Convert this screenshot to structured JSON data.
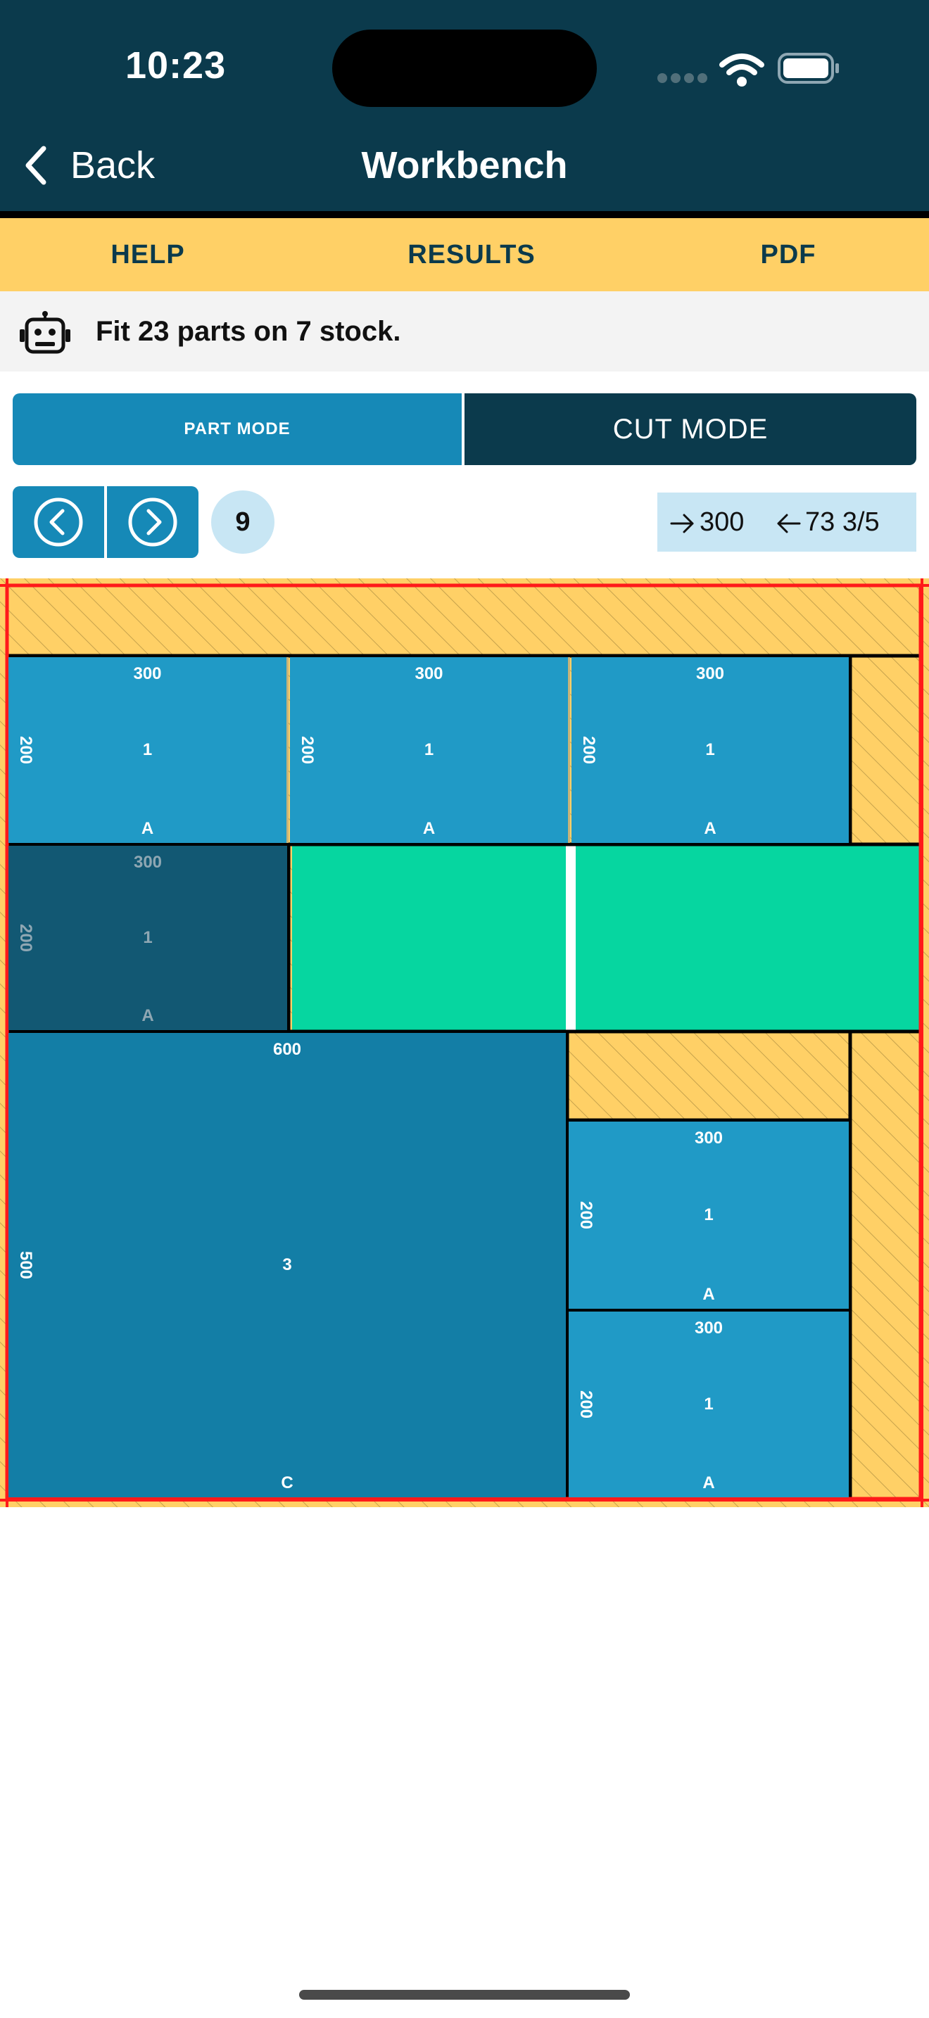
{
  "status_bar": {
    "time": "10:23"
  },
  "nav": {
    "back_label": "Back",
    "title": "Workbench"
  },
  "tabs": [
    {
      "label": "HELP"
    },
    {
      "label": "RESULTS"
    },
    {
      "label": "PDF"
    }
  ],
  "info": {
    "message": "Fit 23 parts on 7 stock."
  },
  "modes": {
    "part_label": "PART MODE",
    "cut_label": "CUT MODE",
    "active": "PART MODE"
  },
  "pager": {
    "page": "9",
    "measure_right": "300",
    "measure_left": "73 3/5"
  },
  "colors": {
    "header": "#0b3a4c",
    "tab_bar": "#ffd066",
    "accent": "#1689b7",
    "part_light": "#209ac6",
    "part_medium": "#137ea6",
    "part_dark": "#125873",
    "selected": "#06d6a0",
    "waste": "#ffd066",
    "stock_border": "#ff1a1a"
  },
  "board": {
    "parts": [
      {
        "width": "300",
        "height": "200",
        "quantity": "1",
        "label": "A"
      },
      {
        "width": "300",
        "height": "200",
        "quantity": "1",
        "label": "A"
      },
      {
        "width": "300",
        "height": "200",
        "quantity": "1",
        "label": "A"
      },
      {
        "width": "300",
        "height": "200",
        "quantity": "1",
        "label": "A"
      },
      {
        "width": "600",
        "height": "500",
        "quantity": "3",
        "label": "C"
      },
      {
        "width": "300",
        "height": "200",
        "quantity": "1",
        "label": "A"
      },
      {
        "width": "300",
        "height": "200",
        "quantity": "1",
        "label": "A"
      }
    ]
  }
}
